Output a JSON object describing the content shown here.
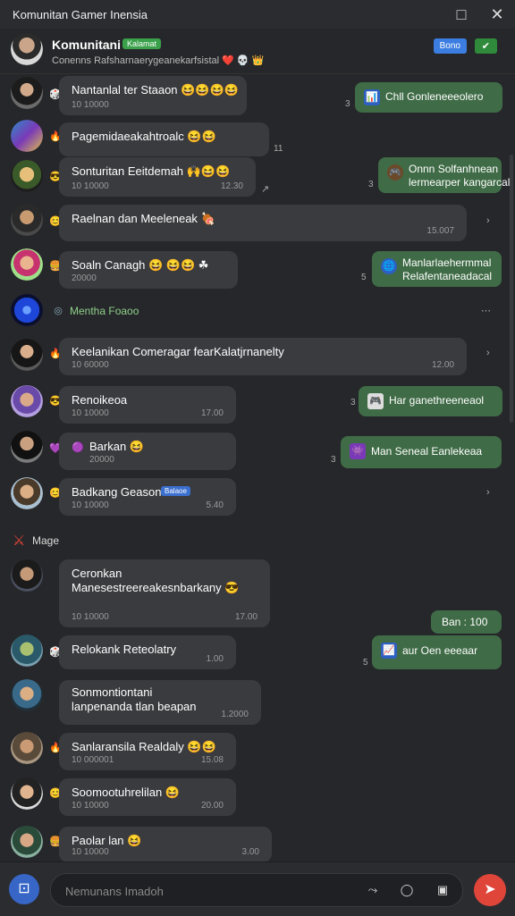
{
  "window": {
    "title": "Komunitan Gamer Inensia",
    "maximize_icon": "□",
    "close_icon": "✕"
  },
  "header": {
    "name": "Komunitani",
    "tag": "Kalamat",
    "subtitle": "Conenns Rafsharnaerygeanekarfsistal ❤️ 💀 👑",
    "btn1": "Bono",
    "btn2": "✔"
  },
  "messages": [
    {
      "text": "Nantanlal ter Staaon 😆😆😆😆",
      "meta": "10 10000",
      "time": ""
    },
    {
      "text": "Pagemidaeakahtroalc 😆😆",
      "meta": "",
      "time": ""
    },
    {
      "text": "Sonturitan Eeitdemah 🙌😆😆",
      "meta": "10 10000",
      "time": "12.30"
    },
    {
      "text": "Raelnan dan Meeleneak 🍖",
      "meta": "",
      "time": "15.007"
    },
    {
      "text": "Soaln Canagh 😆 😆😆 ☘",
      "meta": "20000",
      "time": ""
    },
    {
      "text": "Mentha Foaoo",
      "meta": "",
      "time": ""
    },
    {
      "text": "Keelanikan Comeragar fearKalatjrnanelty",
      "meta": "10 60000",
      "time": "12.00"
    },
    {
      "text": "Renoikeoa",
      "meta": "10 10000",
      "time": "17.00"
    },
    {
      "text": "Barkan 😆",
      "meta": "20000",
      "time": ""
    },
    {
      "text": "Badkang Geason",
      "meta": "10 10000",
      "time": "5.40"
    },
    {
      "text": "Ceronkan",
      "text2": "Manesestreereakesnbarkany 😎",
      "meta": "10 10000",
      "time": "17.00"
    },
    {
      "text": "Relokank Reteolatry",
      "meta": "",
      "time": "1.00"
    },
    {
      "text": "Sonmontiontani",
      "text2": "lanpenanda tlan beapan",
      "meta": "",
      "time": "1.2000"
    },
    {
      "text": "Sanlaransila Realdaly 😆😆",
      "meta": "10 000001",
      "time": "15.08"
    },
    {
      "text": "Soomootuhrelilan 😆",
      "meta": "10 10000",
      "time": "20.00"
    },
    {
      "text": "Paolar lan 😆",
      "meta": "10 10000",
      "time": "3.00"
    }
  ],
  "green_msgs": [
    {
      "text": "Chll Gonleneeeolero"
    },
    {
      "text": "Onnn Solfanhnean",
      "text2": "lermearper kangarcal"
    },
    {
      "text": "Manlarlaehermmal",
      "text2": "Relafentaneadacal"
    },
    {
      "text": "Har ganethreeneaol"
    },
    {
      "text": "Man Seneal Eanlekeaa"
    },
    {
      "text": "Ban : 100"
    },
    {
      "text": "aur Oen eeeaar"
    }
  ],
  "divider": "Mage",
  "badge": "Balaoe",
  "composer": {
    "placeholder": "Nemunans Imadoh",
    "send_icon": "➤"
  }
}
